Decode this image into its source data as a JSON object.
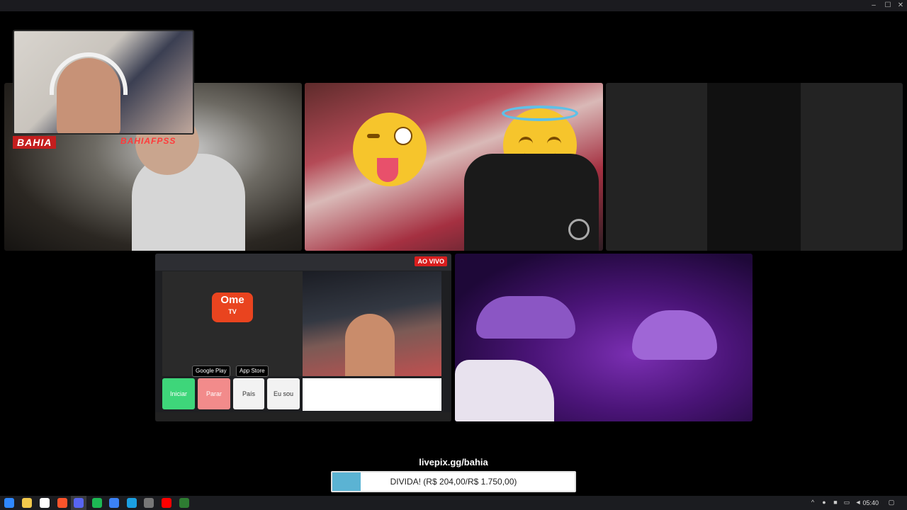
{
  "window": {
    "minimize_icon": "minimize-icon",
    "maximize_icon": "maximize-icon",
    "close_icon": "close-icon",
    "minimize_glyph": "–",
    "maximize_glyph": "☐",
    "close_glyph": "✕"
  },
  "overlay": {
    "brand_left": "BAHIA",
    "brand_right": "BAHIAFPSS"
  },
  "tile_live": {
    "badge": "AO VIVO",
    "ome_logo": "Ome",
    "ome_logo_sub": "TV",
    "google_play": "Google Play",
    "app_store": "App Store",
    "btn_start": "Iniciar",
    "btn_stop": "Parar",
    "btn_country": "País",
    "btn_iam": "Eu sou"
  },
  "donation": {
    "url": "livepix.gg/bahia",
    "goal_text": "DIVIDA! (R$ 204,00/R$ 1.750,00)",
    "progress_fraction": 0.117
  },
  "taskbar": {
    "clock": "05:40",
    "icons": [
      "windows-start-icon",
      "file-explorer-icon",
      "store-icon",
      "brave-icon",
      "discord-icon",
      "spotify-icon",
      "app-a-icon",
      "edge-icon",
      "obs-icon",
      "youtube-icon",
      "terminal-icon"
    ],
    "colors": {
      "start": "#2f88ff",
      "explorer": "#f2c94c",
      "store": "#ffffff",
      "brave": "#fb542b",
      "discord": "#5865f2",
      "spotify": "#1db954",
      "app_a": "#3b82f6",
      "edge": "#1ba0e2",
      "obs": "#777777",
      "youtube": "#ff0000",
      "terminal": "#2e7d32"
    }
  }
}
